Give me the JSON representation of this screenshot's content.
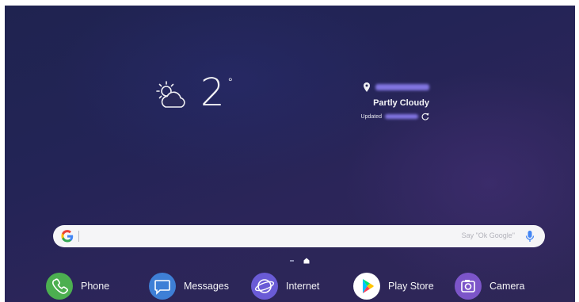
{
  "weather": {
    "temperature": "2",
    "degree_symbol": "°",
    "condition": "Partly Cloudy",
    "updated_label": "Updated",
    "icon": "partly-sunny-icon"
  },
  "search": {
    "logo": "G",
    "placeholder": "Say \"Ok Google\"",
    "mic_icon": "mic-icon"
  },
  "dock": {
    "apps": [
      {
        "label": "Phone",
        "icon": "phone-icon",
        "color": "#4caf50"
      },
      {
        "label": "Messages",
        "icon": "messages-icon",
        "color": "#3e7fd6"
      },
      {
        "label": "Internet",
        "icon": "internet-icon",
        "color": "#6a5bd6"
      },
      {
        "label": "Play Store",
        "icon": "play-store-icon",
        "color": "#ffffff"
      },
      {
        "label": "Camera",
        "icon": "camera-icon",
        "color": "#7c55c9"
      }
    ]
  },
  "colors": {
    "wallpaper": "#232456",
    "search_bar": "#f5f5f7",
    "mic_blue": "#4285f4"
  }
}
